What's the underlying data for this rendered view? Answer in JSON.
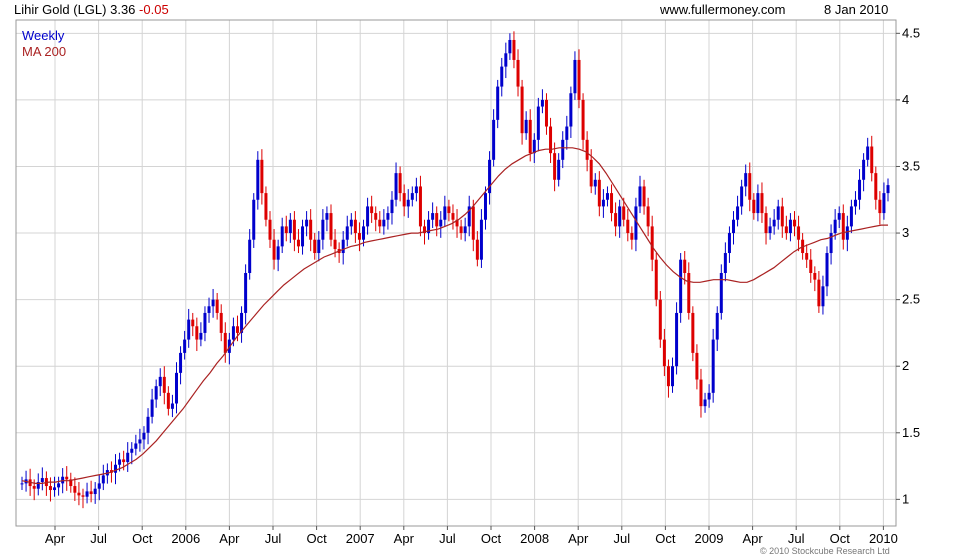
{
  "header": {
    "title": "Lihir Gold (LGL)",
    "price": "3.36",
    "change": "-0.05",
    "site": "www.fullermoney.com",
    "date": "8 Jan 2010"
  },
  "footer": {
    "copyright": "© 2010 Stockcube Research Ltd"
  },
  "colors": {
    "up": "#0000cc",
    "down": "#dd0000",
    "ma": "#aa2222",
    "grid": "#d4d4d4"
  },
  "chart_data": {
    "type": "candlestick",
    "legend": [
      "Weekly",
      "MA 200"
    ],
    "ylim": [
      0.8,
      4.6
    ],
    "yticks": [
      1,
      1.5,
      2,
      2.5,
      3,
      3.5,
      4,
      4.5
    ],
    "xlabels": [
      "Apr",
      "Jul",
      "Oct",
      "2006",
      "Apr",
      "Jul",
      "Oct",
      "2007",
      "Apr",
      "Jul",
      "Oct",
      "2008",
      "Apr",
      "Jul",
      "Oct",
      "2009",
      "Apr",
      "Jul",
      "Oct",
      "2010"
    ],
    "grid": true,
    "weekly_close": [
      1.12,
      1.15,
      1.1,
      1.08,
      1.13,
      1.16,
      1.1,
      1.07,
      1.09,
      1.12,
      1.17,
      1.15,
      1.1,
      1.05,
      1.03,
      1.02,
      1.06,
      1.04,
      1.08,
      1.12,
      1.18,
      1.22,
      1.2,
      1.26,
      1.3,
      1.28,
      1.35,
      1.38,
      1.42,
      1.45,
      1.5,
      1.62,
      1.75,
      1.85,
      1.92,
      1.8,
      1.68,
      1.72,
      1.95,
      2.1,
      2.2,
      2.35,
      2.3,
      2.2,
      2.25,
      2.4,
      2.45,
      2.5,
      2.4,
      2.25,
      2.1,
      2.2,
      2.3,
      2.25,
      2.4,
      2.7,
      2.95,
      3.25,
      3.55,
      3.3,
      3.1,
      2.95,
      2.8,
      2.9,
      3.05,
      3.0,
      3.1,
      2.95,
      2.9,
      3.05,
      3.1,
      2.95,
      2.85,
      2.95,
      3.1,
      3.15,
      2.95,
      2.88,
      2.85,
      2.95,
      3.05,
      3.1,
      3.0,
      2.95,
      3.05,
      3.2,
      3.15,
      3.1,
      3.05,
      3.1,
      3.15,
      3.25,
      3.45,
      3.3,
      3.2,
      3.25,
      3.3,
      3.35,
      3.05,
      3.0,
      3.1,
      3.15,
      3.05,
      3.1,
      3.2,
      3.15,
      3.1,
      3.05,
      3.0,
      3.05,
      3.2,
      2.95,
      2.8,
      3.1,
      3.3,
      3.55,
      3.85,
      4.1,
      4.25,
      4.35,
      4.45,
      4.3,
      4.1,
      3.75,
      3.85,
      3.6,
      3.7,
      3.95,
      4.0,
      3.8,
      3.6,
      3.4,
      3.55,
      3.7,
      3.8,
      4.05,
      4.3,
      4.0,
      3.7,
      3.55,
      3.35,
      3.4,
      3.2,
      3.25,
      3.3,
      3.15,
      3.05,
      3.2,
      3.1,
      3.0,
      2.95,
      3.2,
      3.35,
      3.2,
      3.05,
      2.8,
      2.5,
      2.2,
      2.0,
      1.85,
      2.0,
      2.4,
      2.8,
      2.7,
      2.4,
      2.1,
      1.9,
      1.7,
      1.75,
      1.8,
      2.2,
      2.4,
      2.7,
      2.85,
      3.0,
      3.1,
      3.2,
      3.35,
      3.45,
      3.25,
      3.15,
      3.3,
      3.15,
      3.0,
      3.05,
      3.1,
      3.2,
      3.05,
      3.0,
      3.1,
      3.05,
      2.95,
      2.85,
      2.8,
      2.7,
      2.65,
      2.45,
      2.6,
      2.85,
      3.0,
      3.1,
      3.15,
      2.95,
      3.05,
      3.2,
      3.25,
      3.4,
      3.55,
      3.65,
      3.45,
      3.25,
      3.15,
      3.3,
      3.36
    ],
    "ma200": [
      1.14,
      1.13,
      1.12,
      1.12,
      1.13,
      1.13,
      1.14,
      1.14,
      1.15,
      1.16,
      1.17,
      1.18,
      1.19,
      1.2,
      1.22,
      1.24,
      1.27,
      1.3,
      1.34,
      1.39,
      1.44,
      1.5,
      1.56,
      1.62,
      1.68,
      1.75,
      1.82,
      1.89,
      1.95,
      2.02,
      2.08,
      2.15,
      2.22,
      2.28,
      2.34,
      2.4,
      2.46,
      2.51,
      2.56,
      2.61,
      2.65,
      2.69,
      2.73,
      2.76,
      2.79,
      2.82,
      2.84,
      2.86,
      2.88,
      2.9,
      2.91,
      2.93,
      2.94,
      2.95,
      2.96,
      2.97,
      2.98,
      2.99,
      3.0,
      3.0,
      3.01,
      3.02,
      3.03,
      3.05,
      3.07,
      3.1,
      3.14,
      3.19,
      3.25,
      3.31,
      3.37,
      3.43,
      3.48,
      3.52,
      3.55,
      3.58,
      3.6,
      3.62,
      3.63,
      3.63,
      3.64,
      3.64,
      3.64,
      3.63,
      3.61,
      3.57,
      3.52,
      3.45,
      3.37,
      3.29,
      3.21,
      3.13,
      3.05,
      2.97,
      2.89,
      2.82,
      2.76,
      2.71,
      2.67,
      2.64,
      2.63,
      2.63,
      2.64,
      2.65,
      2.65,
      2.65,
      2.64,
      2.63,
      2.63,
      2.65,
      2.68,
      2.71,
      2.74,
      2.78,
      2.82,
      2.86,
      2.89,
      2.91,
      2.93,
      2.95,
      2.96,
      2.98,
      3.0,
      3.01,
      3.02,
      3.03,
      3.04,
      3.05,
      3.06,
      3.06
    ]
  }
}
